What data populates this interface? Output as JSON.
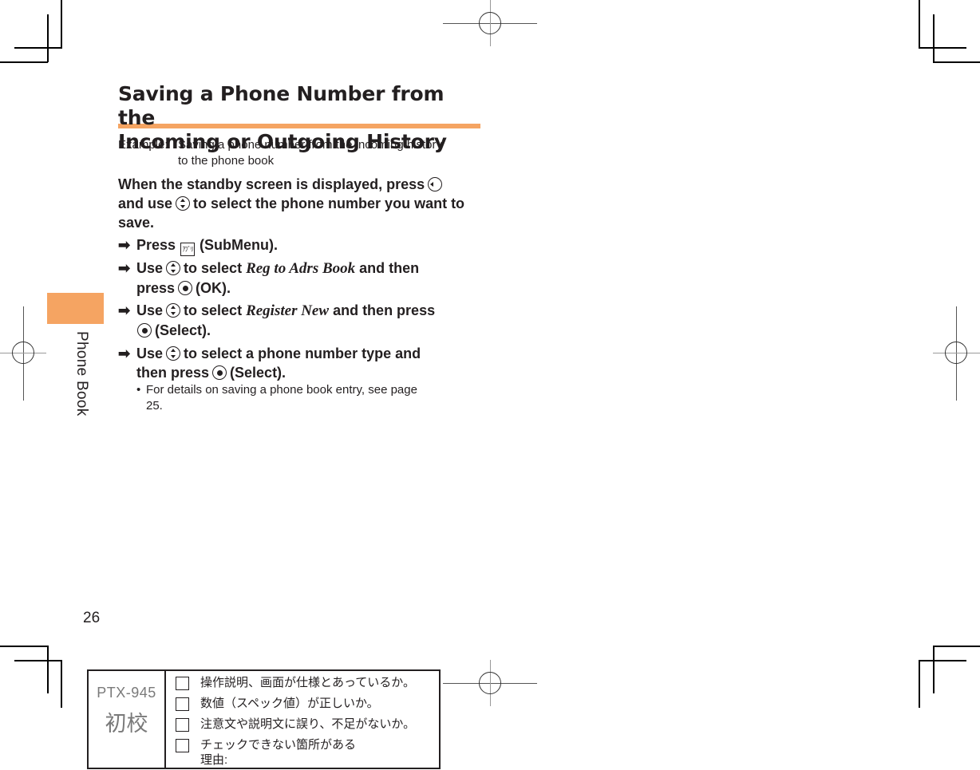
{
  "page": {
    "section_tab": "Phone Book",
    "page_number": "26",
    "accent_color": "#f5a462"
  },
  "title": {
    "line1": "Saving a Phone Number from the",
    "line2": "Incoming or Outgoing History"
  },
  "example": {
    "label": "Example:",
    "line1": "Saving a phone number from the incoming history",
    "line2": "to the phone book"
  },
  "lead": {
    "part1": "When the standby screen is displayed, press",
    "key1": "left-key-icon",
    "part2": "and use",
    "key2": "up-down-key-icon",
    "part3": "to select the phone number you want to save."
  },
  "steps": [
    {
      "arrow": "➡",
      "prefix": "Press",
      "key": "app-key-icon",
      "key_label": "ｱﾌﾟﾘ",
      "suffix": "(SubMenu)."
    },
    {
      "arrow": "➡",
      "prefix": "Use",
      "key": "up-down-key-icon",
      "mid": "to select",
      "menu": "Reg to Adrs Book",
      "after": "and then",
      "line2_prefix": "press",
      "key2": "center-key-icon",
      "line2_suffix": "(OK)."
    },
    {
      "arrow": "➡",
      "prefix": "Use",
      "key": "up-down-key-icon",
      "mid": "to select",
      "menu": "Register New",
      "after": "and then press",
      "key2": "center-key-icon",
      "line2_suffix": "(Select)."
    },
    {
      "arrow": "➡",
      "prefix": "Use",
      "key": "up-down-key-icon",
      "mid": "to select a phone number type and",
      "line2_prefix": "then press",
      "key2": "center-key-icon",
      "line2_suffix": "(Select)."
    }
  ],
  "note": {
    "bullet": "•",
    "line1": "For details on saving a phone book entry, see page",
    "line2": "25."
  },
  "proof_box": {
    "code": "PTX-945",
    "stage": "初校",
    "items": [
      {
        "label": "操作説明、画面が仕様とあっているか。",
        "checked": false
      },
      {
        "label": "数値（スペック値）が正しいか。",
        "checked": false
      },
      {
        "label": "注意文や説明文に誤り、不足がないか。",
        "checked": false
      },
      {
        "label": "チェックできない箇所がある",
        "sub": "理由:",
        "checked": false
      }
    ]
  }
}
